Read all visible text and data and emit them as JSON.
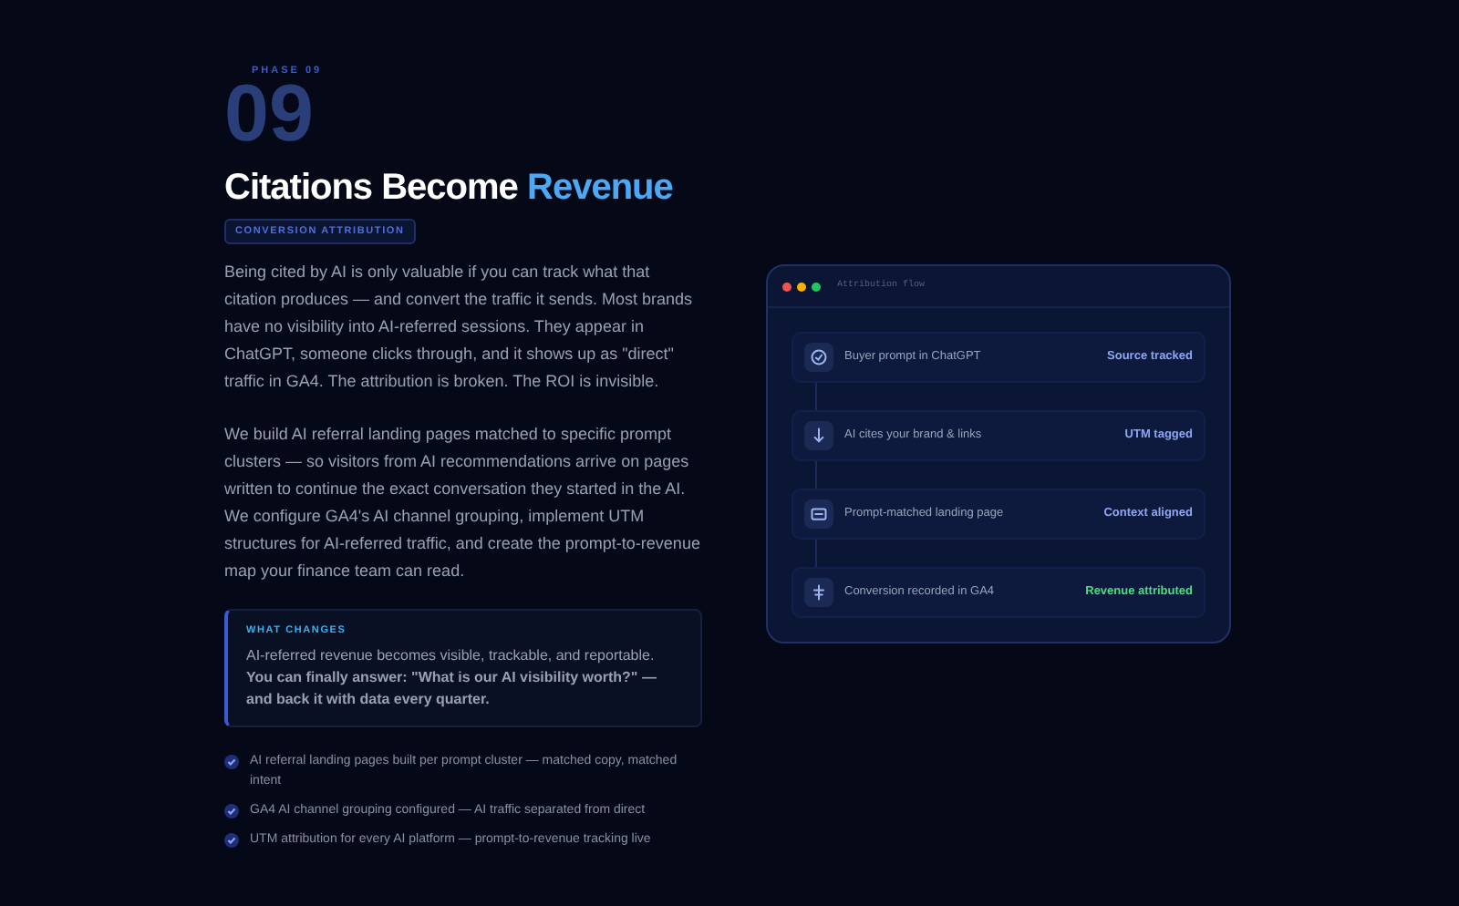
{
  "phase": {
    "label": "PHASE 09",
    "number": "09"
  },
  "heading": {
    "main": "Citations Become",
    "accent": "Revenue"
  },
  "tag": "CONVERSION ATTRIBUTION",
  "paragraphs": [
    "Being cited by AI is only valuable if you can track what that citation produces — and convert the traffic it sends. Most brands have no visibility into AI-referred sessions. They appear in ChatGPT, someone clicks through, and it shows up as \"direct\" traffic in GA4. The attribution is broken. The ROI is invisible.",
    "We build AI referral landing pages matched to specific prompt clusters — so visitors from AI recommendations arrive on pages written to continue the exact conversation they started in the AI. We configure GA4's AI channel grouping, implement UTM structures for AI-referred traffic, and create the prompt-to-revenue map your finance team can read."
  ],
  "callout": {
    "title": "WHAT CHANGES",
    "text": "AI-referred revenue becomes visible, trackable, and reportable. **You can finally answer: \"What is our AI visibility worth?\" — and back it with data every quarter.**"
  },
  "checklist": [
    {
      "text": "AI referral landing pages built per prompt cluster — matched copy, matched intent",
      "checked": true
    },
    {
      "text": "GA4 AI channel grouping configured — AI traffic separated from direct",
      "checked": true
    },
    {
      "text": "UTM attribution for every AI platform — prompt-to-revenue tracking live",
      "checked": true
    }
  ],
  "flow": {
    "title": "Attribution flow",
    "steps": [
      {
        "kind": "check",
        "label": "Buyer prompt in ChatGPT",
        "status": "Source tracked",
        "color": "#8fa6f5"
      },
      {
        "kind": "arrow",
        "label": "AI cites your brand & links",
        "status": "UTM tagged",
        "color": "#8fa6f5"
      },
      {
        "kind": "page",
        "label": "Prompt-matched landing page",
        "status": "Context aligned",
        "color": "#8fa6f5"
      },
      {
        "kind": "merge",
        "label": "Conversion recorded in GA4",
        "status": "Revenue attributed",
        "color": "#4ade80"
      }
    ]
  }
}
